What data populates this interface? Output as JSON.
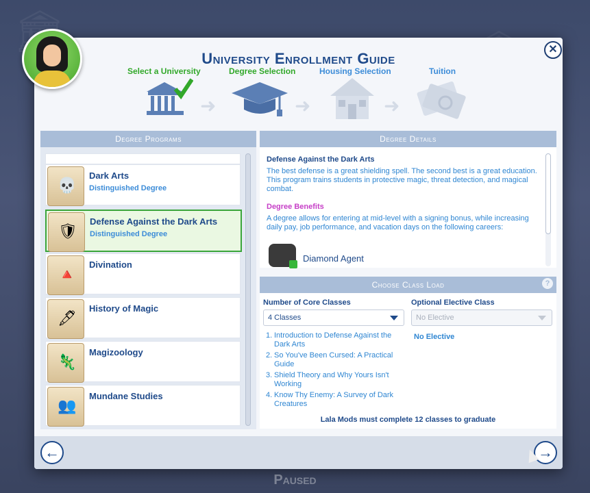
{
  "window": {
    "title": "University Enrollment Guide",
    "status": "Paused"
  },
  "steps": [
    {
      "label": "Select a University",
      "state": "done",
      "icon": "university-building-icon"
    },
    {
      "label": "Degree Selection",
      "state": "done",
      "icon": "graduation-cap-icon"
    },
    {
      "label": "Housing Selection",
      "state": "todo",
      "icon": "house-icon"
    },
    {
      "label": "Tuition",
      "state": "todo",
      "icon": "money-icon"
    }
  ],
  "programs": {
    "header": "Degree Programs",
    "items": [
      {
        "name": "Dark Arts",
        "type": "Distinguished Degree",
        "icon": "skull-scroll-icon"
      },
      {
        "name": "Defense Against the Dark Arts",
        "type": "Distinguished Degree",
        "icon": "shield-wand-scroll-icon",
        "selected": true
      },
      {
        "name": "Divination",
        "type": "",
        "icon": "eye-pyramid-scroll-icon"
      },
      {
        "name": "History of Magic",
        "type": "",
        "icon": "quill-scroll-icon"
      },
      {
        "name": "Magizoology",
        "type": "",
        "icon": "creature-scroll-icon"
      },
      {
        "name": "Mundane Studies",
        "type": "",
        "icon": "people-scroll-icon"
      }
    ]
  },
  "details": {
    "header": "Degree Details",
    "title": "Defense Against the Dark Arts",
    "description": "The best defense is a great shielding spell. The second best is a great education. This program trains students in protective magic, threat detection, and magical combat.",
    "benefits_label": "Degree Benefits",
    "benefits_desc": "A degree allows for entering at mid-level with a signing bonus, while increasing daily pay, job performance, and vacation days on the following careers:",
    "career": "Diamond Agent"
  },
  "class_load": {
    "header": "Choose Class Load",
    "core_label": "Number of Core Classes",
    "core_value": "4 Classes",
    "elective_label": "Optional Elective Class",
    "elective_value": "No Elective",
    "classes": [
      "Introduction to Defense Against the Dark Arts",
      "So You've Been Cursed: A Practical Guide",
      "Shield Theory and Why Yours Isn't Working",
      "Know Thy Enemy: A Survey of Dark Creatures"
    ],
    "elective_selected": "No Elective",
    "grad_prefix": "Lala Mods must complete",
    "grad_count": "12",
    "grad_suffix": "classes to graduate"
  },
  "colors": {
    "accent": "#1f4a8a",
    "done": "#32a82a",
    "todo": "#3c8cd8",
    "benefits": "#c63fc7"
  }
}
